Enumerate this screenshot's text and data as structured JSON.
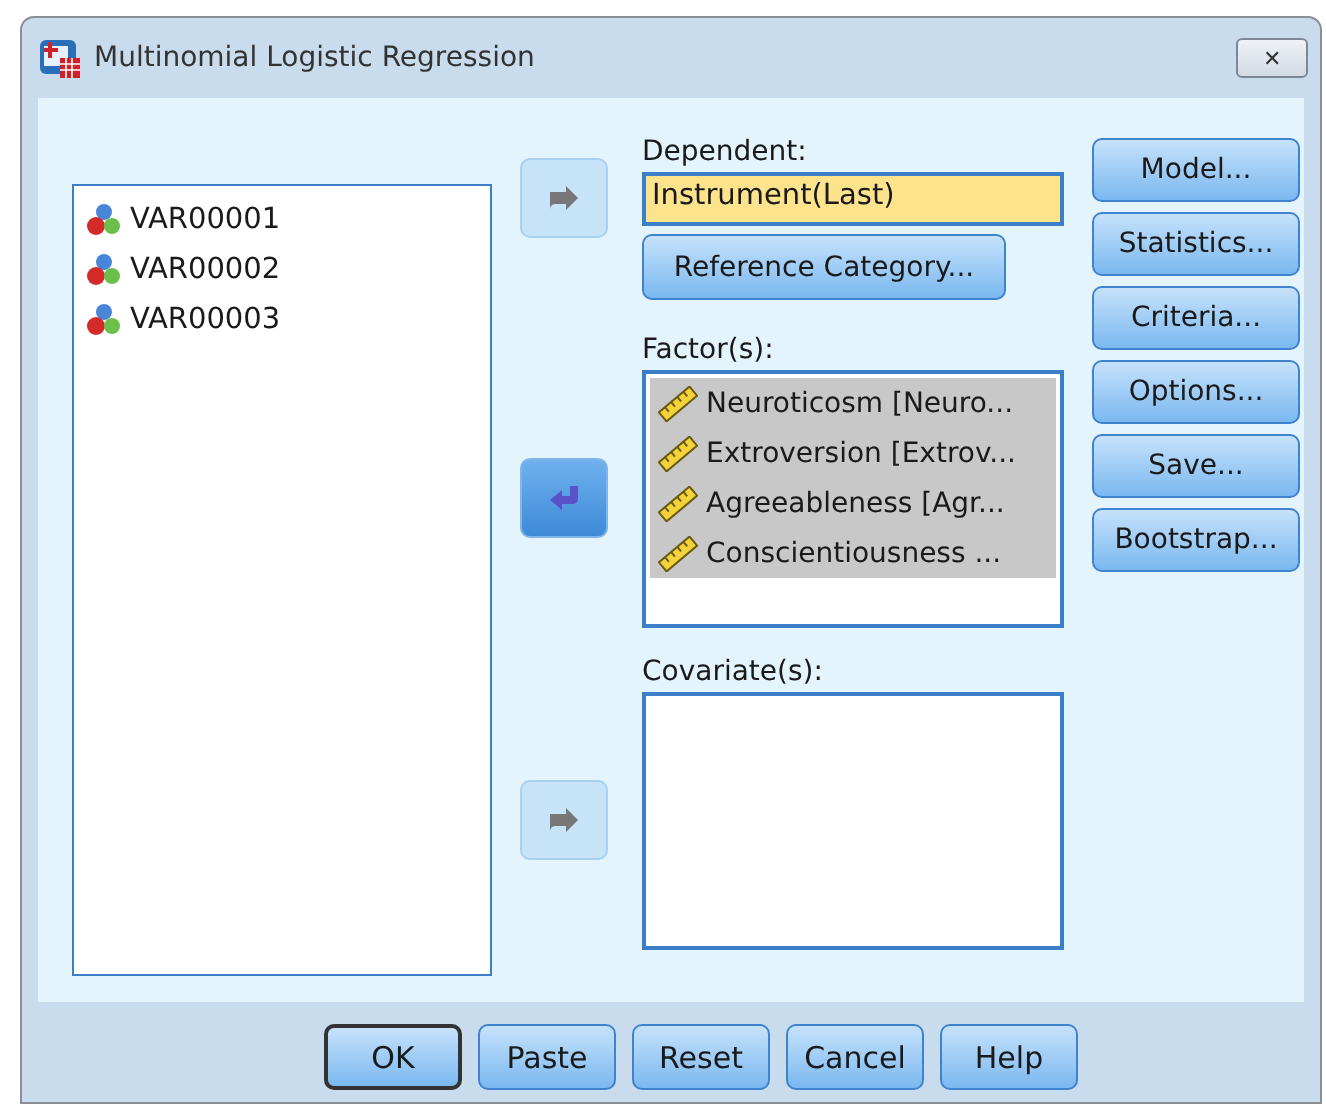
{
  "window": {
    "title": "Multinomial Logistic Regression",
    "close": "✕"
  },
  "variables": [
    {
      "name": "VAR00001"
    },
    {
      "name": "VAR00002"
    },
    {
      "name": "VAR00003"
    }
  ],
  "arrows": [
    {
      "kind": "add",
      "disabled": true
    },
    {
      "kind": "remove",
      "disabled": false
    },
    {
      "kind": "add",
      "disabled": true
    }
  ],
  "dependent": {
    "label": "Dependent:",
    "value": "Instrument(Last)",
    "button": "Reference Category..."
  },
  "factors": {
    "label": "Factor(s):",
    "items": [
      {
        "name": "Neuroticosm [Neuro...",
        "selected": true
      },
      {
        "name": "Extroversion [Extrov...",
        "selected": true
      },
      {
        "name": "Agreeableness [Agr...",
        "selected": true
      },
      {
        "name": "Conscientiousness ...",
        "selected": true
      }
    ]
  },
  "covariates": {
    "label": "Covariate(s):"
  },
  "side_buttons": [
    "Model...",
    "Statistics...",
    "Criteria...",
    "Options...",
    "Save...",
    "Bootstrap..."
  ],
  "bottom_buttons": [
    {
      "label": "OK",
      "default": true
    },
    {
      "label": "Paste",
      "default": false
    },
    {
      "label": "Reset",
      "default": false
    },
    {
      "label": "Cancel",
      "default": false
    },
    {
      "label": "Help",
      "default": false
    }
  ]
}
